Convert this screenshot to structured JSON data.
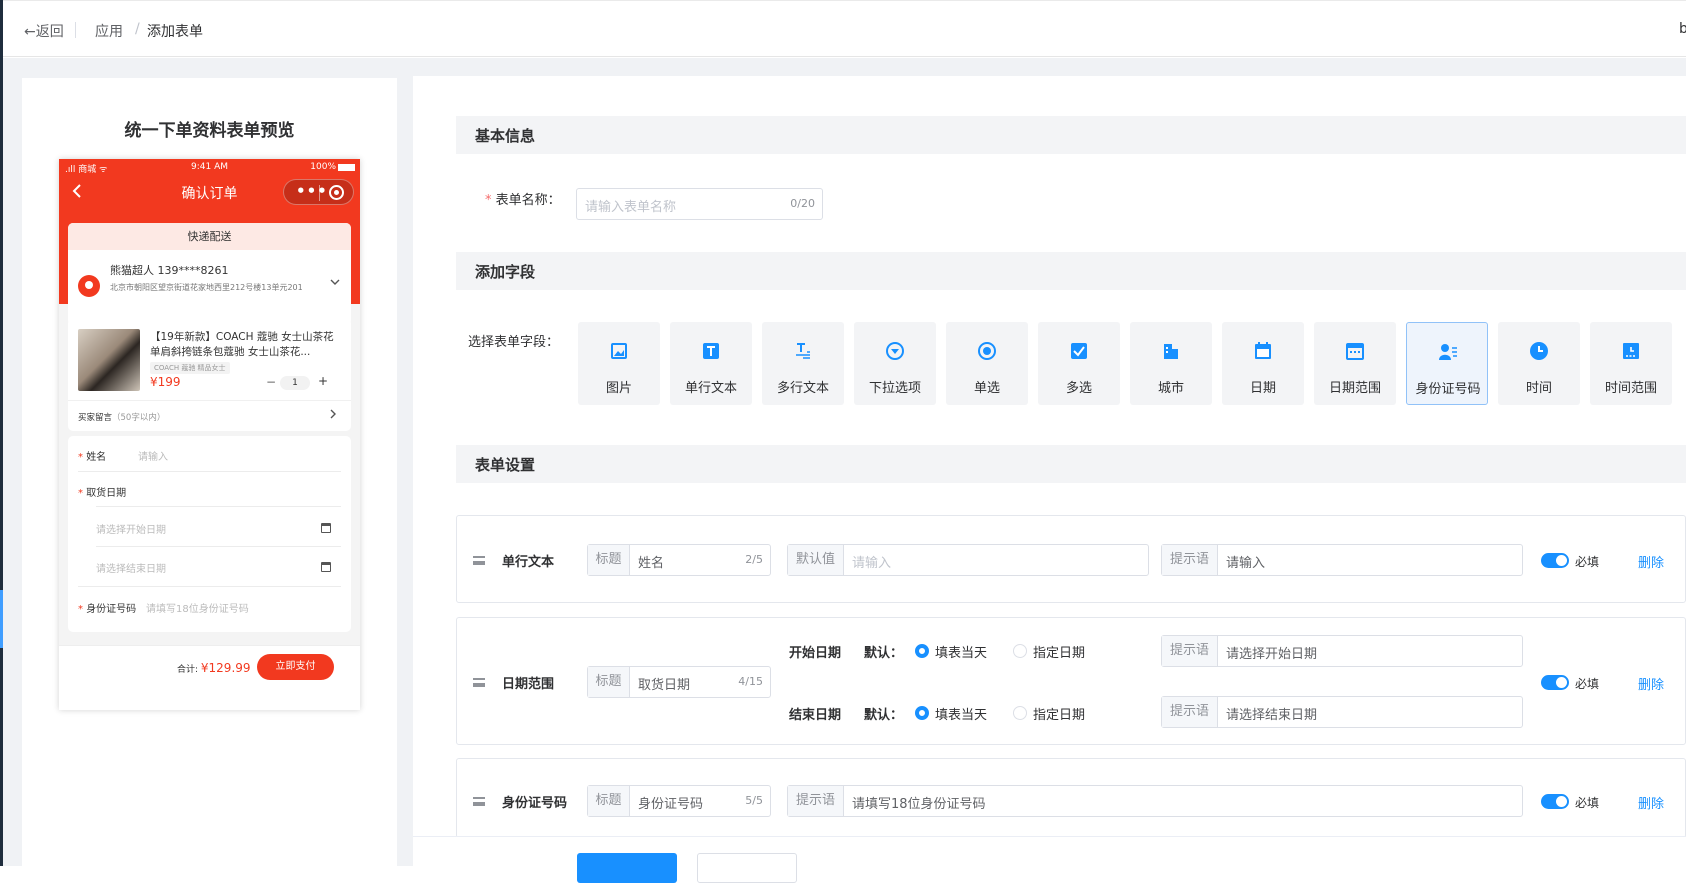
{
  "topbar": {
    "back": "←返回",
    "crumb1": "应用",
    "crumb_sep": "/",
    "crumb2": "添加表单",
    "cut_text": "b"
  },
  "preview": {
    "title": "统一下单资料表单预览",
    "status": {
      "carrier": ".ıll 商城 ᯤ",
      "time": "9:41 AM",
      "battery": "100%"
    },
    "nav_title": "确认订单",
    "delivery_tab": "快递配送",
    "address": {
      "name": "熊猫超人  139****8261",
      "detail": "北京市朝阳区望京街道花家地西里212号楼13单元201"
    },
    "product": {
      "title": "【19年新款】COACH 蔻驰 女士山茶花单肩斜挎链条包蔻驰 女士山茶花...",
      "tag": "COACH 蔻驰 精品女士",
      "price": "¥199",
      "minus": "−",
      "qty": "1",
      "plus": "+"
    },
    "message": {
      "label": "买家留言",
      "hint": "（50字以内）"
    },
    "form": {
      "star": "*",
      "name_label": "姓名",
      "name_ph": "请输入",
      "date_label": "取货日期",
      "start_ph": "请选择开始日期",
      "end_ph": "请选择结束日期",
      "id_label": "身份证号码",
      "id_ph": "请填写18位身份证号码"
    },
    "footer": {
      "total_label": "合计: ",
      "total": "¥129.99",
      "pay": "立即支付"
    }
  },
  "basic": {
    "section": "基本信息",
    "star": "*",
    "name_label": "表单名称：",
    "name_ph": "请输入表单名称",
    "name_count": "0/20"
  },
  "fields_section": {
    "section": "添加字段",
    "select_label": "选择表单字段：",
    "tiles": [
      {
        "label": "图片",
        "icon": "image-icon"
      },
      {
        "label": "单行文本",
        "icon": "text-icon"
      },
      {
        "label": "多行文本",
        "icon": "multiline-text-icon"
      },
      {
        "label": "下拉选项",
        "icon": "dropdown-icon"
      },
      {
        "label": "单选",
        "icon": "radio-icon"
      },
      {
        "label": "多选",
        "icon": "checkbox-icon"
      },
      {
        "label": "城市",
        "icon": "city-icon"
      },
      {
        "label": "日期",
        "icon": "calendar-icon"
      },
      {
        "label": "日期范围",
        "icon": "date-range-icon"
      },
      {
        "label": "身份证号码",
        "icon": "id-card-icon"
      },
      {
        "label": "时间",
        "icon": "clock-icon"
      },
      {
        "label": "时间范围",
        "icon": "time-range-icon"
      }
    ]
  },
  "settings": {
    "section": "表单设置",
    "rows": [
      {
        "type": "单行文本",
        "title_prefix": "标题",
        "title_value": "姓名",
        "title_count": "2/5",
        "default_prefix": "默认值",
        "default_ph": "请输入",
        "hint_prefix": "提示语",
        "hint_value": "请输入",
        "required": "必填",
        "delete": "删除"
      },
      {
        "type": "日期范围",
        "title_prefix": "标题",
        "title_value": "取货日期",
        "title_count": "4/15",
        "start_label": "开始日期",
        "end_label": "结束日期",
        "default_label": "默认：",
        "opt_today": "填表当天",
        "opt_specified": "指定日期",
        "hint_prefix": "提示语",
        "start_hint": "请选择开始日期",
        "end_hint": "请选择结束日期",
        "required": "必填",
        "delete": "删除"
      },
      {
        "type": "身份证号码",
        "title_prefix": "标题",
        "title_value": "身份证号码",
        "title_count": "5/5",
        "hint_prefix": "提示语",
        "hint_value": "请填写18位身份证号码",
        "required": "必填",
        "delete": "删除"
      }
    ]
  },
  "colors": {
    "accent": "#1890ff",
    "brand_red": "#f2391f",
    "required": "#f56c6c"
  }
}
